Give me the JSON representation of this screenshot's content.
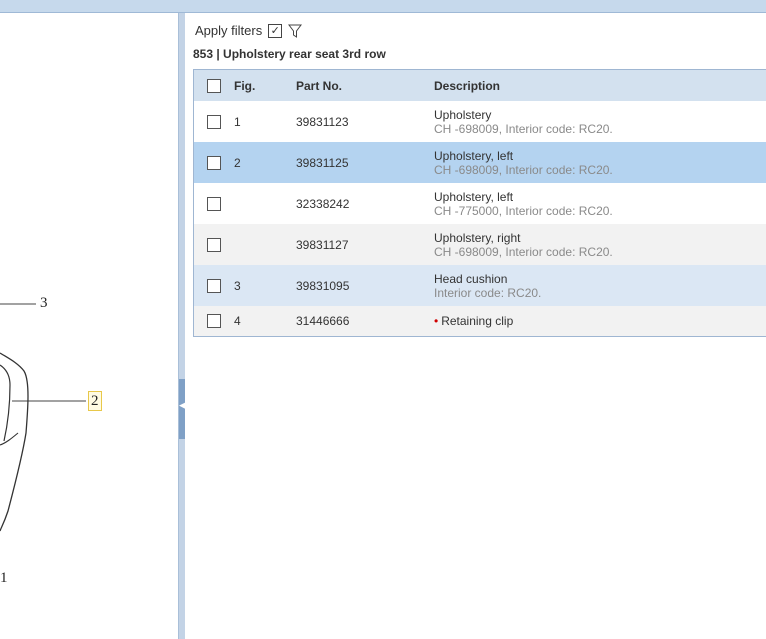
{
  "callouts": {
    "c3": "3",
    "c2": "2",
    "c1": "1"
  },
  "filters": {
    "apply_label": "Apply filters"
  },
  "section": {
    "title": "853  |  Upholstery rear seat 3rd row"
  },
  "table": {
    "headers": {
      "fig": "Fig.",
      "part_no": "Part No.",
      "description": "Description"
    },
    "rows": [
      {
        "fig": "1",
        "part_no": "39831123",
        "desc": "Upholstery",
        "sub": "CH -698009, Interior code: RC20."
      },
      {
        "fig": "2",
        "part_no": "39831125",
        "desc": "Upholstery, left",
        "sub": "CH -698009, Interior code: RC20."
      },
      {
        "fig": "",
        "part_no": "32338242",
        "desc": "Upholstery, left",
        "sub": "CH -775000, Interior code: RC20."
      },
      {
        "fig": "",
        "part_no": "39831127",
        "desc": "Upholstery, right",
        "sub": "CH -698009, Interior code: RC20."
      },
      {
        "fig": "3",
        "part_no": "39831095",
        "desc": "Head cushion",
        "sub": "Interior code: RC20."
      },
      {
        "fig": "4",
        "part_no": "31446666",
        "desc": "Retaining clip",
        "sub": ""
      }
    ]
  },
  "icons": {
    "filter": "funnel-icon",
    "checked": "checkbox-checked-icon",
    "collapse": "chevron-left-icon"
  },
  "colors": {
    "header_bg": "#d3e1ef",
    "selected_row": "#b4d3f0",
    "accent_red": "#d00000"
  }
}
